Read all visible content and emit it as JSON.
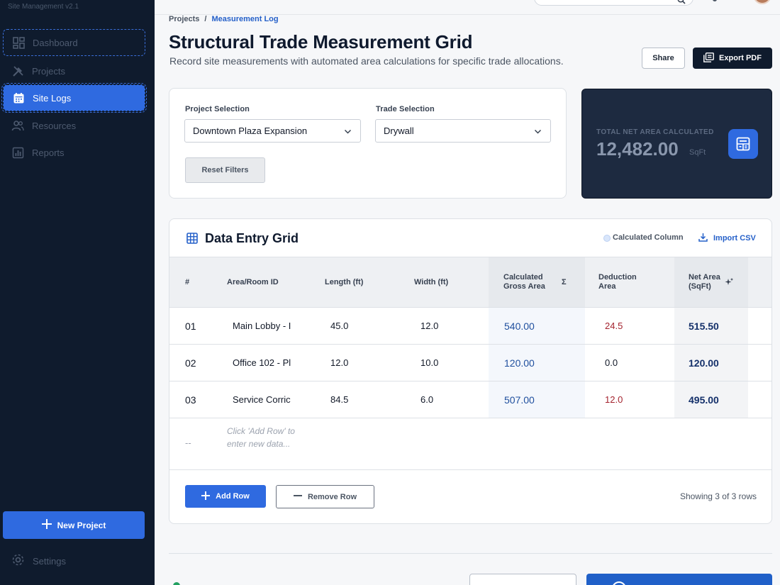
{
  "app": {
    "version_label": "Site Management v2.1"
  },
  "sidebar": {
    "items": [
      {
        "label": "Dashboard",
        "icon": "dashboard-icon"
      },
      {
        "label": "Projects",
        "icon": "tools-icon"
      },
      {
        "label": "Site Logs",
        "icon": "calendar-icon",
        "active": true
      },
      {
        "label": "Resources",
        "icon": "users-icon"
      },
      {
        "label": "Reports",
        "icon": "chart-icon"
      }
    ],
    "new_project_label": "New Project",
    "settings_label": "Settings"
  },
  "breadcrumb": {
    "parent": "Projects",
    "separator": "/",
    "current": "Measurement Log"
  },
  "header": {
    "title": "Structural Trade Measurement Grid",
    "subtitle": "Record site measurements with automated area calculations for specific trade allocations.",
    "share_label": "Share",
    "export_label": "Export PDF"
  },
  "filters": {
    "project_label": "Project Selection",
    "project_value": "Downtown Plaza Expansion",
    "trade_label": "Trade Selection",
    "trade_value": "Drywall",
    "reset_label": "Reset Filters"
  },
  "stat": {
    "label": "TOTAL NET AREA CALCULATED",
    "value": "12,482.00",
    "unit": "SqFt"
  },
  "grid": {
    "title": "Data Entry Grid",
    "legend_label": "Calculated Column",
    "import_label": "Import CSV",
    "columns": {
      "index": "#",
      "area": "Area/Room ID",
      "length": "Length (ft)",
      "width": "Width (ft)",
      "gross": "Calculated Gross Area",
      "gross_symbol": "Σ",
      "deduction": "Deduction Area",
      "net": "Net Area (SqFt)"
    },
    "rows": [
      {
        "index": "01",
        "area": "Main Lobby - I",
        "length": "45.0",
        "width": "12.0",
        "gross": "540.00",
        "deduction": "24.5",
        "net": "515.50"
      },
      {
        "index": "02",
        "area": "Office 102 - Pl",
        "length": "12.0",
        "width": "10.0",
        "gross": "120.00",
        "deduction": "0.0",
        "net": "120.00"
      },
      {
        "index": "03",
        "area": "Service Corric",
        "length": "84.5",
        "width": "6.0",
        "gross": "507.00",
        "deduction": "12.0",
        "net": "495.00"
      }
    ],
    "placeholder_index": "--",
    "placeholder_text": "Click 'Add Row' to enter new data...",
    "add_row_label": "Add Row",
    "remove_row_label": "Remove Row",
    "showing_text": "Showing 3 of 3 rows"
  },
  "colors": {
    "sidebar_bg": "#0f1b2d",
    "accent": "#2f6ae0",
    "stat_card_bg": "#1d2a40",
    "deduction_text": "#a4232e",
    "net_text": "#14306a"
  }
}
